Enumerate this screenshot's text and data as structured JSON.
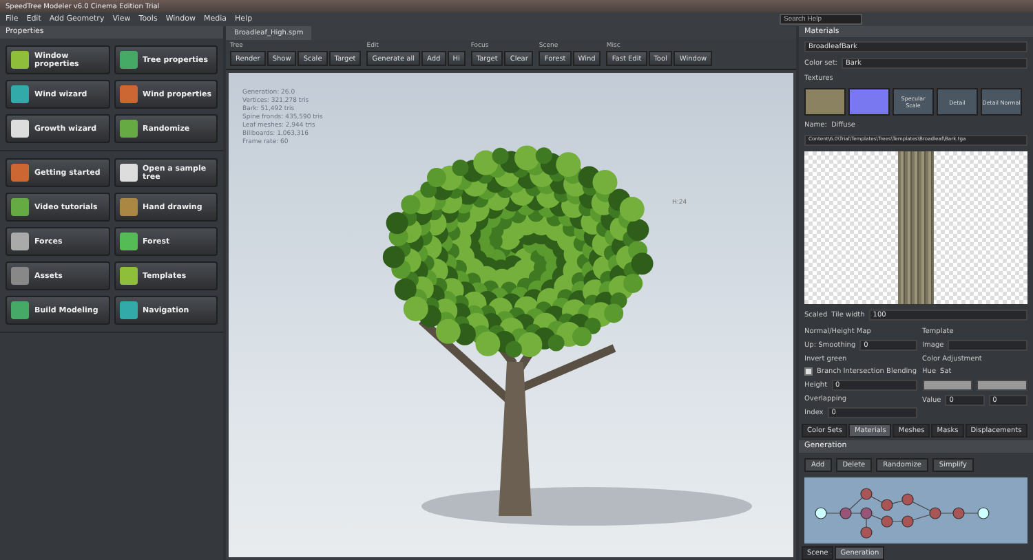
{
  "window": {
    "title": "SpeedTree Modeler v6.0 Cinema Edition Trial"
  },
  "menu": [
    "File",
    "Edit",
    "Add Geometry",
    "View",
    "Tools",
    "Window",
    "Media",
    "Help"
  ],
  "search": {
    "placeholder": "Search Help"
  },
  "left_panel": {
    "title": "Properties",
    "groups": [
      [
        "Window properties",
        "Tree properties",
        "Wind wizard",
        "Wind properties",
        "Growth wizard",
        "Randomize"
      ],
      [
        "Getting started",
        "Open a sample tree",
        "Video tutorials",
        "Hand drawing",
        "Forces",
        "Forest",
        "Assets",
        "Templates",
        "Build Modeling",
        "Navigation"
      ]
    ]
  },
  "document_tab": {
    "label": "Broadleaf_High.spm"
  },
  "toolbar": [
    {
      "title": "Tree",
      "buttons": [
        "Render",
        "Show",
        "Scale",
        "Target"
      ]
    },
    {
      "title": "Edit",
      "buttons": [
        "Generate all",
        "Add",
        "Hi"
      ]
    },
    {
      "title": "Focus",
      "buttons": [
        "Target",
        "Clear"
      ]
    },
    {
      "title": "Scene",
      "buttons": [
        "Forest",
        "Wind"
      ]
    },
    {
      "title": "Misc",
      "buttons": [
        "Fast Edit",
        "Tool",
        "Window"
      ]
    }
  ],
  "viewport": {
    "stats": [
      "Generation: 26.0",
      "Vertices: 321,278 tris",
      "Bark: 51,492 tris",
      "Spine fronds: 435,590 tris",
      "Leaf meshes: 2,944 tris",
      "Billboards: 1,063,316",
      "Frame rate: 60"
    ],
    "height_label": "H:24"
  },
  "materials": {
    "title": "Materials",
    "material": "BroadleafBark",
    "color_set_label": "Color set:",
    "color_set": "Bark",
    "textures_label": "Textures",
    "textures": [
      "Specular Scale",
      "Detail",
      "Detail Normal"
    ],
    "name_label": "Name:",
    "name": "Diffuse",
    "path": "Content\\6.0\\Trial\\Templates\\Trees\\Templates\\Broadleaf\\Bark.tga",
    "scale_label": "Scaled",
    "tile_label": "Tile width",
    "tile_value": "100",
    "normal_title": "Normal/Height Map",
    "smoothing_label": "Up: Smoothing",
    "smoothing_value": "0",
    "invert_label": "Invert green",
    "template_title": "Template",
    "template_label": "Image",
    "blend_label": "Branch Intersection Blending",
    "blend_checked": true,
    "height_label": "Height",
    "height_value": "0",
    "overlap_title": "Overlapping",
    "index_label": "Index",
    "index_value": "0",
    "color_title": "Color Adjustment",
    "hue_label": "Hue",
    "sat_label": "Sat",
    "value_label": "Value",
    "value_a": "0",
    "value_b": "0",
    "tabs": [
      {
        "label": "Color Sets",
        "selected": false
      },
      {
        "label": "Materials",
        "selected": true
      },
      {
        "label": "Meshes",
        "selected": false
      },
      {
        "label": "Masks",
        "selected": false
      },
      {
        "label": "Displacements",
        "selected": false
      }
    ]
  },
  "generation": {
    "title": "Generation",
    "buttons": [
      "Add",
      "Delete",
      "Randomize",
      "Simplify"
    ]
  },
  "bottom_tabs": [
    {
      "label": "Scene",
      "selected": false
    },
    {
      "label": "Generation",
      "selected": true
    }
  ]
}
